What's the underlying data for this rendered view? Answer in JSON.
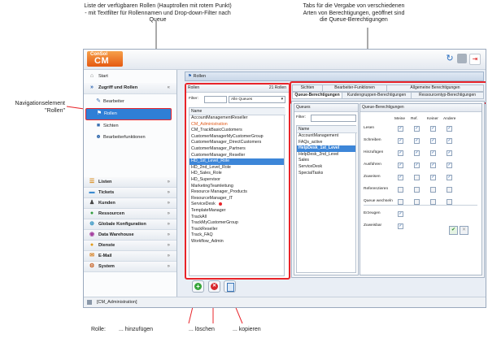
{
  "annotations": {
    "roles_list": "Liste der verfügbaren Rollen (Hauptrollen mit rotem Punkt)\n- mit Textfilter für Rollennamen und Drop-down-Filter nach Queue",
    "tabs": "Tabs für die Vergabe von verschiedenen\nArten von Berechtigungen, geöffnet sind\ndie Queue-Berechtigungen",
    "nav_element": "Navigationselement\n\"Rollen\"",
    "role_label": "Rolle:",
    "add": "... hinzufügen",
    "delete": "... löschen",
    "copy": "... kopieren"
  },
  "app": {
    "logo_small": "ConSol",
    "logo_big": "CM",
    "status_user": "[CM_Administration]"
  },
  "sidebar": {
    "start": "Start",
    "access_group": "Zugriff und Rollen",
    "items": [
      "Bearbeiter",
      "Rollen",
      "Sichten",
      "Bearbeiterfunktionen"
    ],
    "groups": [
      "Listen",
      "Tickets",
      "Kunden",
      "Ressourcen",
      "Globale Konfiguration",
      "Data Warehouse",
      "Dienste",
      "E-Mail",
      "System"
    ]
  },
  "panel": {
    "title": "Rollen"
  },
  "roles": {
    "header": "Rollen",
    "count": "21 Rollen",
    "filter_label": "Filter:",
    "queue_select": "Alle Queues",
    "col_name": "Name",
    "items": [
      "AccountManagementReseller",
      "CM_Administration",
      "CM_TrackBasicCustomers",
      "CustomerManagerMyCustomerGroup",
      "CustomerManager_DirectCustomers",
      "CustomerManager_Partners",
      "CustomerManager_Reseller",
      "HD_1st_Level_Role",
      "HD_2nd_Level_Role",
      "HD_Sales_Role",
      "HD_Supervisor",
      "MarketingTeamleitung",
      "Resource Manager_Products",
      "ResourceManager_IT",
      "ServiceDesk",
      "TemplateManager",
      "TrackAll",
      "TrackMyCustomerGroup",
      "TrackReseller",
      "Track_FAQ",
      "Workflow_Admin"
    ],
    "selected_index": 7,
    "highlight_index": 1,
    "main_role_index": 14
  },
  "tabs": {
    "row1": [
      "Sichten",
      "Bearbeiter-Funktionen",
      "Allgemeine Berechtigungen"
    ],
    "row2": [
      "Queue-Berechtigungen",
      "Kundengruppen-Berechtigungen",
      "Ressourcentyp-Berechtigungen"
    ]
  },
  "queues": {
    "header": "Queues",
    "filter_label": "Filter:",
    "col_name": "Name",
    "items": [
      "AccountManagement",
      "FAQs_active",
      "HelpDesk_1st_Level",
      "HelpDesk_2nd_Level",
      "Sales",
      "ServiceDesk",
      "SpecialTasks"
    ],
    "selected_index": 2
  },
  "permissions": {
    "header": "Queue-Berechtigungen",
    "columns": [
      "Meine",
      "Ref.",
      "Keiner",
      "Andere"
    ],
    "rows": [
      {
        "label": "Lesen",
        "checks": [
          true,
          true,
          true,
          true
        ]
      },
      {
        "label": "Schreiben",
        "checks": [
          true,
          true,
          true,
          true
        ]
      },
      {
        "label": "Hinzufügen",
        "checks": [
          true,
          true,
          true,
          true
        ]
      },
      {
        "label": "Ausführen",
        "checks": [
          true,
          true,
          true,
          true
        ]
      },
      {
        "label": "Zuweisen",
        "checks": [
          true,
          false,
          true,
          true
        ]
      },
      {
        "label": "Referenzieren",
        "checks": [
          false,
          false,
          false,
          false
        ]
      },
      {
        "label": "Queue wechseln",
        "checks": [
          false,
          false,
          false,
          false
        ]
      }
    ],
    "extra": [
      {
        "label": "Erzeugen",
        "checked": true
      },
      {
        "label": "Zuweisbar",
        "checked": true
      }
    ]
  }
}
